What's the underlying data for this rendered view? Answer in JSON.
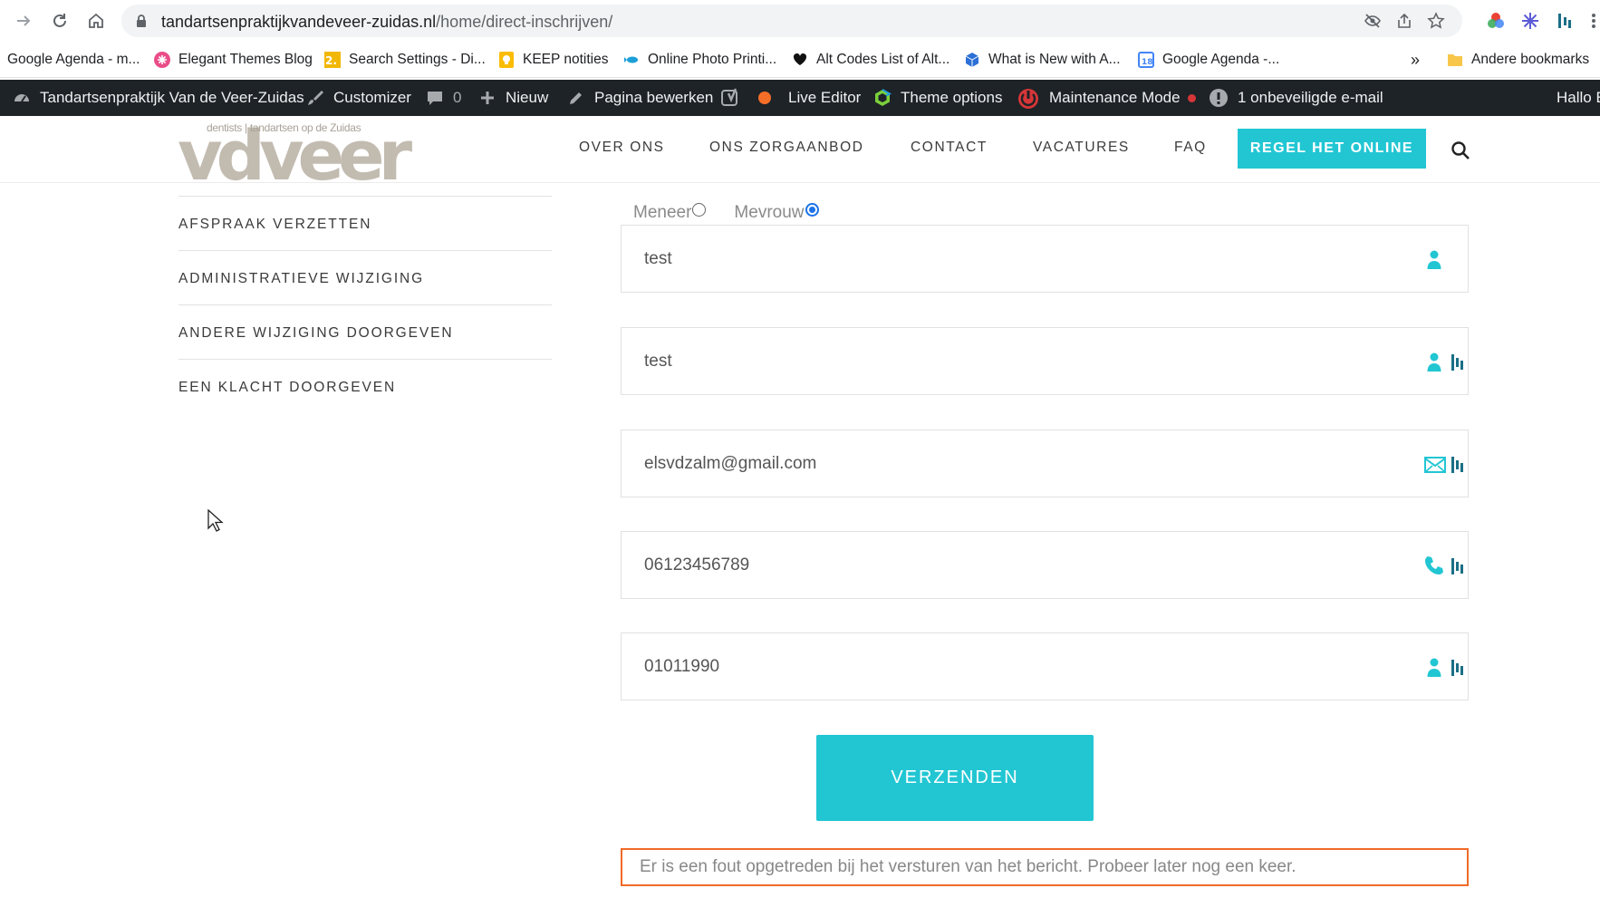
{
  "browser": {
    "url_host": "tandartsenpraktijkvandeveer-zuidas.nl",
    "url_path": "/home/direct-inschrijven/",
    "bookmarks": [
      {
        "label": "Google Agenda - m..."
      },
      {
        "label": "Elegant Themes Blog"
      },
      {
        "label": "Search Settings - Di..."
      },
      {
        "label": "KEEP notities"
      },
      {
        "label": "Online Photo Printi..."
      },
      {
        "label": "Alt Codes List of Alt..."
      },
      {
        "label": "What is New with A..."
      },
      {
        "label": "Google Agenda -..."
      }
    ],
    "bookmarks_overflow": "»",
    "other_bookmarks": "Andere bookmarks"
  },
  "adminbar": {
    "site_name": "Tandartsenpraktijk Van de Veer-Zuidas",
    "customizer": "Customizer",
    "comments_count": "0",
    "new_label": "Nieuw",
    "edit_page": "Pagina bewerken",
    "live_editor": "Live Editor",
    "theme_options": "Theme options",
    "maintenance": "Maintenance Mode",
    "unsafe_email": "1 onbeveiligde e-mail",
    "greeting": "Hallo E"
  },
  "header": {
    "logo_tagline": "dentists | tandartsen op de Zuidas",
    "logo_word": "vdveer",
    "menu": [
      {
        "label": "OVER ONS"
      },
      {
        "label": "ONS ZORGAANBOD"
      },
      {
        "label": "CONTACT"
      },
      {
        "label": "VACATURES"
      },
      {
        "label": "FAQ"
      }
    ],
    "cta": "REGEL HET ONLINE"
  },
  "sidebar": {
    "items": [
      {
        "label": "AFSPRAAK VERZETTEN"
      },
      {
        "label": "ADMINISTRATIEVE WIJZIGING"
      },
      {
        "label": "ANDERE WIJZIGING DOORGEVEN"
      },
      {
        "label": "EEN KLACHT DOORGEVEN"
      }
    ]
  },
  "form": {
    "salutation": {
      "options": [
        {
          "label": "Meneer",
          "checked": false
        },
        {
          "label": "Mevrouw",
          "checked": true
        }
      ]
    },
    "fields": [
      {
        "value": "test",
        "icon": "person-icon"
      },
      {
        "value": "test",
        "icon": "person-icon"
      },
      {
        "value": "elsvdzalm@gmail.com",
        "icon": "envelope-icon"
      },
      {
        "value": "06123456789",
        "icon": "phone-icon"
      },
      {
        "value": "01011990",
        "icon": "person-icon"
      }
    ],
    "submit_label": "VERZENDEN",
    "error_message": "Er is een fout opgetreden bij het versturen van het bericht. Probeer later nog een keer."
  },
  "colors": {
    "accent": "#22c6d3",
    "error_border": "#f06a27",
    "admin_bar": "#1d2327",
    "radio_checked": "#1a73e8"
  }
}
